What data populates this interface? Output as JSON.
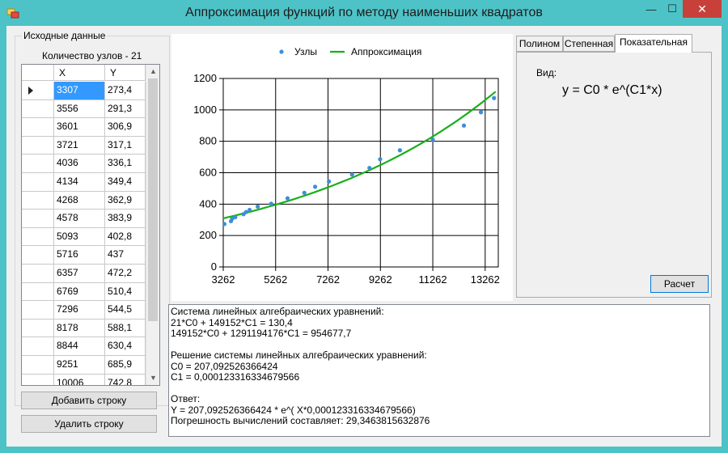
{
  "window": {
    "title": "Аппроксимация функций по методу наименьших квадратов",
    "min_glyph": "—",
    "max_glyph": "☐",
    "close_glyph": "✕"
  },
  "input": {
    "group_title": "Исходные данные",
    "count_label": "Количество узлов - 21",
    "columns": [
      "X",
      "Y"
    ],
    "rows": [
      {
        "x": "3307",
        "y": "273,4"
      },
      {
        "x": "3556",
        "y": "291,3"
      },
      {
        "x": "3601",
        "y": "306,9"
      },
      {
        "x": "3721",
        "y": "317,1"
      },
      {
        "x": "4036",
        "y": "336,1"
      },
      {
        "x": "4134",
        "y": "349,4"
      },
      {
        "x": "4268",
        "y": "362,9"
      },
      {
        "x": "4578",
        "y": "383,9"
      },
      {
        "x": "5093",
        "y": "402,8"
      },
      {
        "x": "5716",
        "y": "437"
      },
      {
        "x": "6357",
        "y": "472,2"
      },
      {
        "x": "6769",
        "y": "510,4"
      },
      {
        "x": "7296",
        "y": "544,5"
      },
      {
        "x": "8178",
        "y": "588,1"
      },
      {
        "x": "8844",
        "y": "630,4"
      },
      {
        "x": "9251",
        "y": "685,9"
      },
      {
        "x": "10006",
        "y": "742,8"
      }
    ],
    "add_button": "Добавить строку",
    "delete_button": "Удалить строку"
  },
  "chart_data": {
    "type": "scatter",
    "legend": [
      "Узлы",
      "Аппроксимация"
    ],
    "legend_placement": "top-center",
    "x_ticks": [
      "3262",
      "5262",
      "7262",
      "9262",
      "11262",
      "13262"
    ],
    "y_ticks": [
      "0",
      "200",
      "400",
      "600",
      "800",
      "1000",
      "1200"
    ],
    "xlim": [
      3262,
      13762
    ],
    "ylim": [
      0,
      1200
    ],
    "grid": true,
    "points_color": "#3c8fd8",
    "line_color": "#1aaf1a",
    "series": [
      {
        "name": "Узлы",
        "x": [
          3307,
          3556,
          3601,
          3721,
          4036,
          4134,
          4268,
          4578,
          5093,
          5716,
          6357,
          6769,
          7296,
          8178,
          8844,
          9251,
          10006,
          11262,
          12450,
          13100,
          13600
        ],
        "y": [
          273.4,
          291.3,
          306.9,
          317.1,
          336.1,
          349.4,
          362.9,
          383.9,
          402.8,
          437,
          472.2,
          510.4,
          544.5,
          588.1,
          630.4,
          685.9,
          742.8,
          810,
          900,
          985,
          1075
        ]
      }
    ],
    "fit": {
      "c0": 207.092526366424,
      "c1": 0.000123316334679566
    }
  },
  "tabs": {
    "items": [
      "Полином",
      "Степенная",
      "Показательная"
    ],
    "active": "Показательная",
    "view_label": "Вид:",
    "formula": "y = C0 * e^(C1*x)",
    "calc_button": "Расчет"
  },
  "output": {
    "lines": [
      "Система линейных алгебраических уравнений:",
      "21*C0 + 149152*C1 = 130,4",
      "149152*C0 + 1291194176*C1 = 954677,7",
      "",
      "Решение системы линейных алгебраических уравнений:",
      "C0 = 207,092526366424",
      "C1 = 0,000123316334679566",
      "",
      "Ответ:",
      "Y = 207,092526366424 * e^( X*0,000123316334679566)",
      "Погрешность вычислений составляет: 29,3463815632876"
    ]
  }
}
